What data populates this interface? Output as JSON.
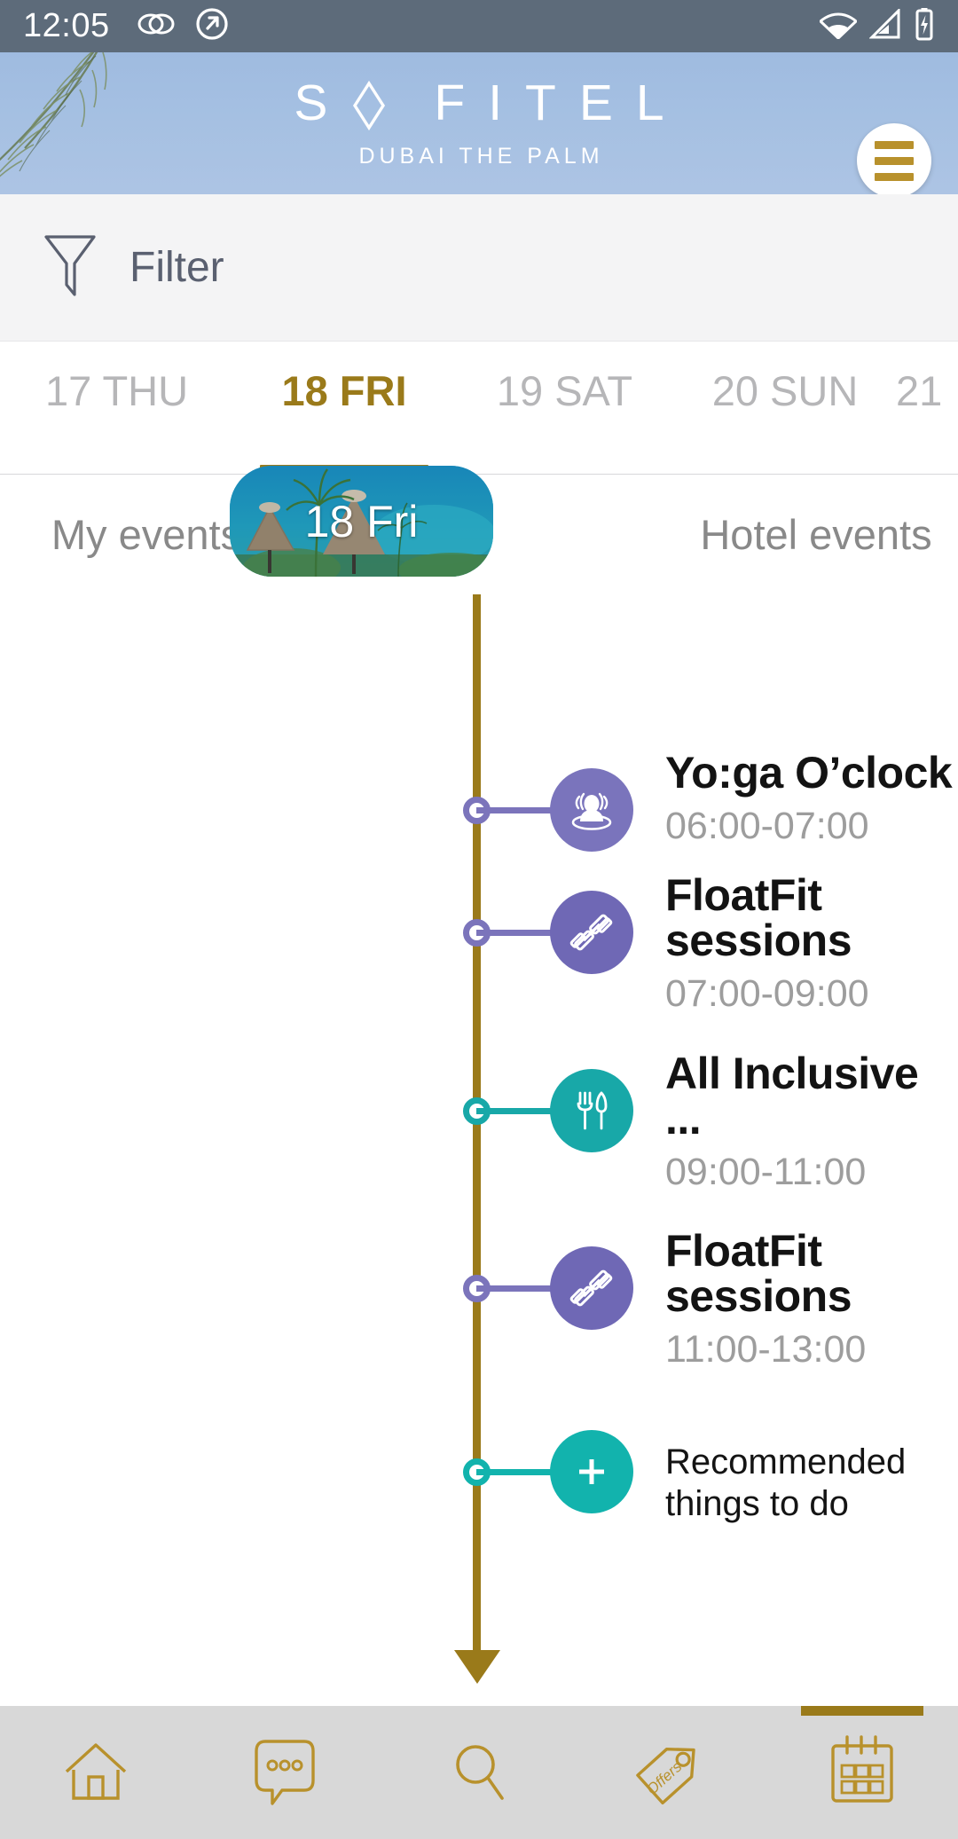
{
  "status_bar": {
    "time": "12:05",
    "left_icons": [
      "link-contacts-icon",
      "at-sign-circle-icon"
    ],
    "right_icons": [
      "wifi-icon",
      "cellular-signal-icon",
      "battery-charging-icon"
    ]
  },
  "hotel_header": {
    "brand": "SOFITEL",
    "location": "DUBAI THE PALM",
    "menu_icon": "hamburger-menu-icon",
    "background_color": "#a5c0e2",
    "accent_color": "#b8912c"
  },
  "filter_bar": {
    "label": "Filter",
    "icon": "funnel-filter-icon"
  },
  "day_tabs": {
    "active_index": 1,
    "items": [
      {
        "label": "17 THU",
        "active": false
      },
      {
        "label": "18 FRI",
        "active": true
      },
      {
        "label": "19 SAT",
        "active": false
      },
      {
        "label": "20 SUN",
        "active": false
      },
      {
        "label": "21",
        "active": false
      }
    ],
    "active_color": "#9a7a1a",
    "inactive_color": "#b6b6b8"
  },
  "columns": {
    "my_events_label": "My events",
    "hotel_events_label": "Hotel events",
    "day_card_label": "18 Fri"
  },
  "timeline": {
    "spine_color": "#9a7a1a",
    "events": [
      {
        "title": "Yo:ga O’clock",
        "time": "06:00-07:00",
        "icon": "spa-yoga-icon",
        "color": "#7a74bc"
      },
      {
        "title": "FloatFit sessions",
        "time": "07:00-09:00",
        "icon": "dumbbell-icon",
        "color": "#6f68b5"
      },
      {
        "title": "All Inclusive ...",
        "time": "09:00-11:00",
        "icon": "fork-knife-icon",
        "color": "#18a8a8"
      },
      {
        "title": "FloatFit sessions",
        "time": "11:00-13:00",
        "icon": "dumbbell-icon",
        "color": "#6f68b5"
      }
    ],
    "add_item": {
      "title": "Recommended things to do",
      "icon": "plus-icon",
      "color": "#12b3ad"
    }
  },
  "bottom_nav": {
    "active_index": 4,
    "accent_color": "#9a7a1a",
    "background_color": "#d8d8d8",
    "items": [
      {
        "name": "home",
        "icon": "home-icon",
        "active": false
      },
      {
        "name": "chat",
        "icon": "chat-bubble-icon",
        "active": false
      },
      {
        "name": "search",
        "icon": "search-icon",
        "active": false
      },
      {
        "name": "offers",
        "icon": "offers-tag-icon",
        "active": false
      },
      {
        "name": "calendar",
        "icon": "calendar-icon",
        "active": true
      }
    ]
  }
}
